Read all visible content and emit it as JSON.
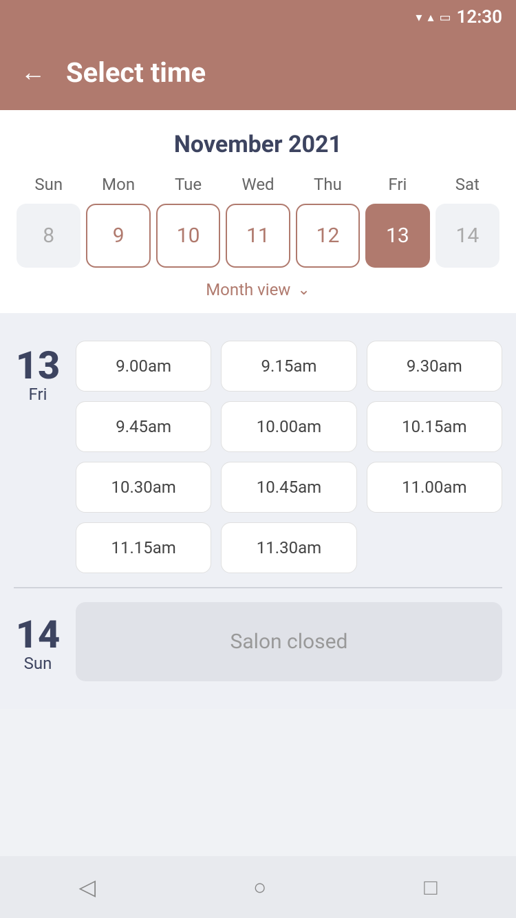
{
  "status_bar": {
    "time": "12:30"
  },
  "header": {
    "title": "Select time",
    "back_label": "←"
  },
  "calendar": {
    "month_year": "November 2021",
    "weekdays": [
      "Sun",
      "Mon",
      "Tue",
      "Wed",
      "Thu",
      "Fri",
      "Sat"
    ],
    "days": [
      {
        "number": "8",
        "state": "inactive"
      },
      {
        "number": "9",
        "state": "available"
      },
      {
        "number": "10",
        "state": "available"
      },
      {
        "number": "11",
        "state": "available"
      },
      {
        "number": "12",
        "state": "available"
      },
      {
        "number": "13",
        "state": "selected"
      },
      {
        "number": "14",
        "state": "inactive"
      }
    ],
    "month_view_label": "Month view"
  },
  "schedule": {
    "days": [
      {
        "number": "13",
        "name": "Fri",
        "time_slots": [
          "9.00am",
          "9.15am",
          "9.30am",
          "9.45am",
          "10.00am",
          "10.15am",
          "10.30am",
          "10.45am",
          "11.00am",
          "11.15am",
          "11.30am"
        ]
      },
      {
        "number": "14",
        "name": "Sun",
        "time_slots": [],
        "closed": true,
        "closed_label": "Salon closed"
      }
    ]
  },
  "bottom_nav": {
    "back_icon": "◁",
    "home_icon": "○",
    "recent_icon": "□"
  }
}
